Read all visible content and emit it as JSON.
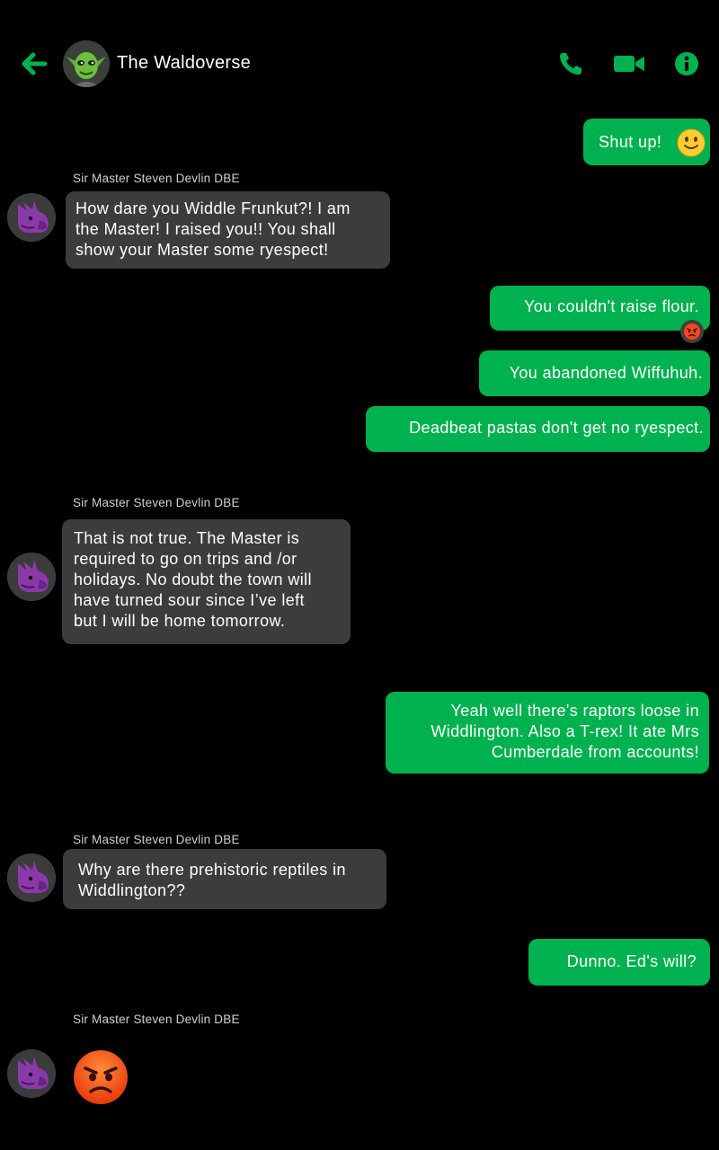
{
  "header": {
    "title": "The Waldoverse",
    "back_icon": "arrow-left-icon",
    "call_icon": "phone-icon",
    "video_icon": "video-camera-icon",
    "info_icon": "info-icon",
    "accent": "#00b150"
  },
  "messages": [
    {
      "direction": "outgoing",
      "text": "Shut up!",
      "emoji": "slightly-smiling-face"
    },
    {
      "direction": "incoming",
      "sender": "Sir Master Steven Devlin DBE",
      "lines": [
        "How dare you Widdle Frunkut?! I am",
        "the Master! I raised you!! You shall",
        "show your Master some ryespect!"
      ]
    },
    {
      "direction": "outgoing",
      "text": "You couldn't raise flour.",
      "reaction": "angry-face"
    },
    {
      "direction": "outgoing",
      "text": "You abandoned Wiffuhuh."
    },
    {
      "direction": "outgoing",
      "text": "Deadbeat pastas don't get no ryespect."
    },
    {
      "direction": "incoming",
      "sender": "Sir Master Steven Devlin DBE",
      "lines": [
        "That is not true. The Master is",
        "required to go on trips and /or",
        "holidays. No doubt the town will",
        "have turned sour since I’ve left",
        "but I will be home tomorrow."
      ]
    },
    {
      "direction": "outgoing",
      "lines": [
        "Yeah well there's raptors loose in",
        "Widdlington. Also a T-rex! It ate Mrs",
        "Cumberdale from accounts!"
      ]
    },
    {
      "direction": "incoming",
      "sender": "Sir Master Steven Devlin DBE",
      "lines": [
        "Why are there prehistoric reptiles in",
        "Widdlington??"
      ]
    },
    {
      "direction": "outgoing",
      "text": "Dunno. Ed's will?"
    },
    {
      "direction": "incoming",
      "sender": "Sir Master Steven Devlin DBE",
      "emoji": "angry-face"
    }
  ],
  "colors": {
    "background": "#000000",
    "outgoing_bubble": "#00b150",
    "incoming_bubble": "#3e3b3b"
  }
}
